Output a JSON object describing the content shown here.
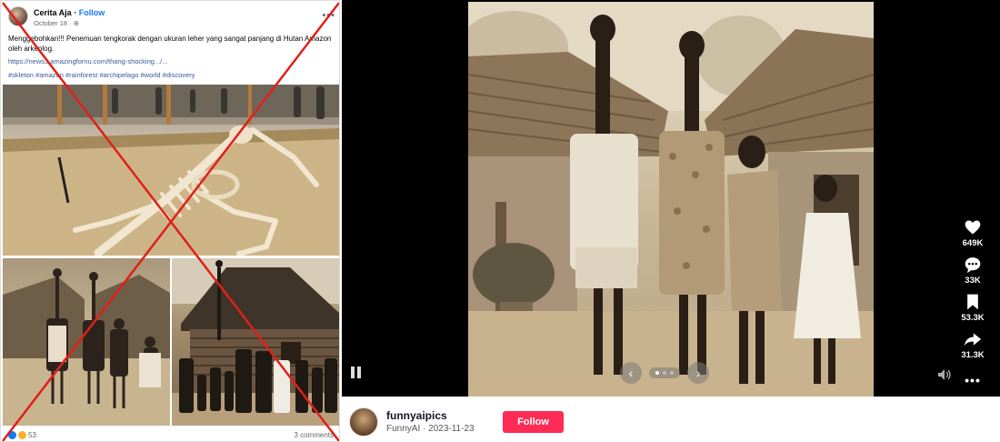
{
  "facebook_post": {
    "author": "Cerita Aja",
    "follow_label": "Follow",
    "date": "October 18 · ⊕",
    "text": "Menggebohkan!!! Penemuan tengkorak dengan ukuran leher yang sangat panjang di Hutan Amazon oleh arkeolog.",
    "link": "https://news3.amazingfornu.com/thang-shocking.../...",
    "hashtags": "#skleton #amazon #rainforest #archipelago #world #discovery",
    "reaction_count": "53",
    "comments": "3 comments",
    "more_icon": "more-dots-icon"
  },
  "tiktok_post": {
    "username": "funnyaipics",
    "meta": "FunnyAI · 2023-11-23",
    "follow_label": "Follow",
    "likes": "649K",
    "comments": "33K",
    "saves": "53.3K",
    "shares": "31.3K",
    "carousel": {
      "total_slides": 3,
      "active_slide": 1
    }
  },
  "colors": {
    "facebook_link": "#385898",
    "facebook_follow": "#1877f2",
    "tiktok_follow": "#fe2c55",
    "debunk_cross": "#e0201b"
  }
}
